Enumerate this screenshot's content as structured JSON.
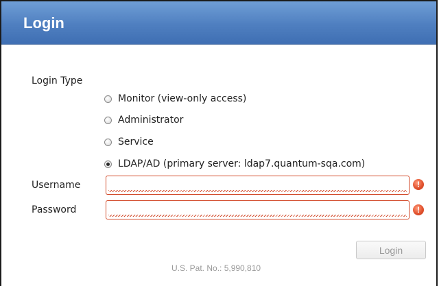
{
  "window": {
    "title": "Login"
  },
  "login_type": {
    "label": "Login Type",
    "options": [
      {
        "label": "Monitor (view-only access)",
        "selected": false
      },
      {
        "label": "Administrator",
        "selected": false
      },
      {
        "label": "Service",
        "selected": false
      },
      {
        "label": "LDAP/AD (primary server: ldap7.quantum-sqa.com)",
        "selected": true
      }
    ]
  },
  "username": {
    "label": "Username",
    "value": "",
    "error_icon": "error-icon"
  },
  "password": {
    "label": "Password",
    "value": "",
    "error_icon": "error-icon"
  },
  "actions": {
    "login_label": "Login"
  },
  "footer": {
    "patent": "U.S. Pat. No.: 5,990,810"
  },
  "colors": {
    "title_bar": "#4f7fc0",
    "error": "#d24a2a"
  }
}
